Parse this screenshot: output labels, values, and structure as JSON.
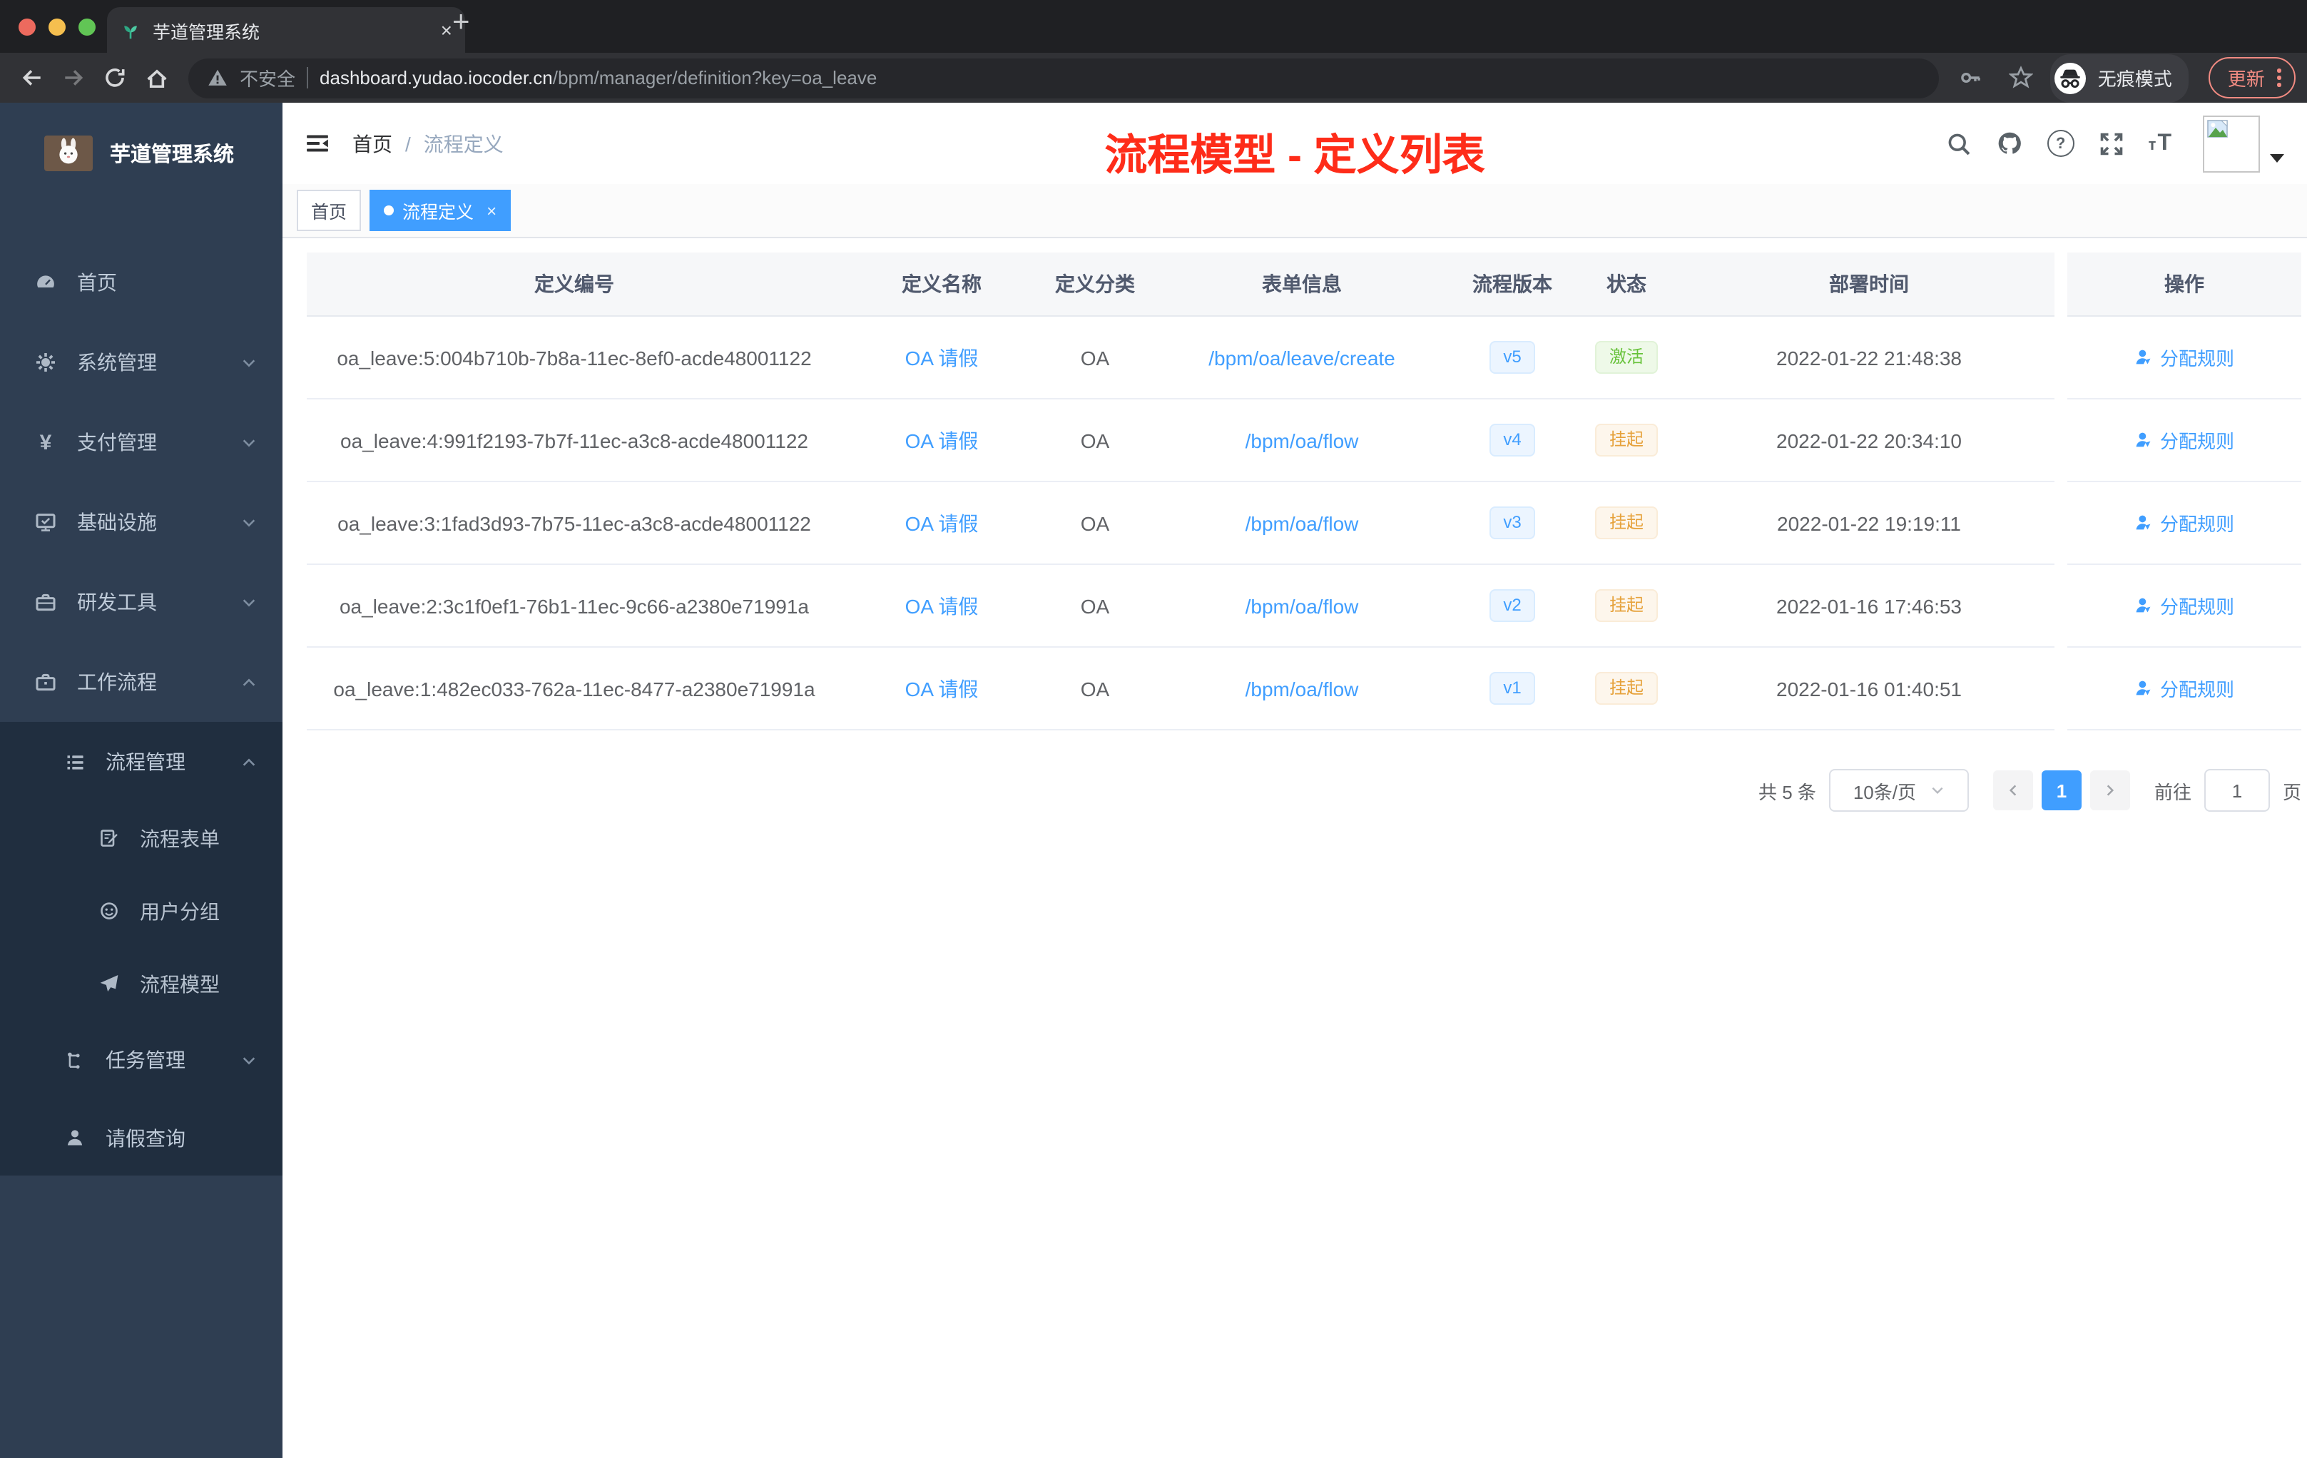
{
  "browser": {
    "tab": {
      "title": "芋道管理系统",
      "close": "×",
      "new_tab": "+"
    },
    "address": {
      "security_label": "不安全",
      "host": "dashboard.yudao.iocoder.cn",
      "path": "/bpm/manager/definition?key=oa_leave"
    },
    "actions": {
      "incognito_label": "无痕模式",
      "update_label": "更新"
    }
  },
  "sidebar": {
    "logo_title": "芋道管理系统",
    "items": [
      {
        "label": "首页",
        "icon": "gauge-icon",
        "expandable": false
      },
      {
        "label": "系统管理",
        "icon": "gear-icon",
        "expandable": true,
        "state": "collapsed"
      },
      {
        "label": "支付管理",
        "icon": "yen-icon",
        "expandable": true,
        "state": "collapsed"
      },
      {
        "label": "基础设施",
        "icon": "monitor-icon",
        "expandable": true,
        "state": "collapsed"
      },
      {
        "label": "研发工具",
        "icon": "toolbox-icon",
        "expandable": true,
        "state": "collapsed"
      },
      {
        "label": "工作流程",
        "icon": "briefcase-icon",
        "expandable": true,
        "state": "expanded"
      },
      {
        "label": "流程管理",
        "icon": "list-icon",
        "expandable": true,
        "state": "expanded"
      },
      {
        "label": "流程表单",
        "icon": "form-icon",
        "expandable": false
      },
      {
        "label": "用户分组",
        "icon": "users-icon",
        "expandable": false
      },
      {
        "label": "流程模型",
        "icon": "paper-plane-icon",
        "expandable": false
      },
      {
        "label": "任务管理",
        "icon": "tree-icon",
        "expandable": true,
        "state": "collapsed"
      },
      {
        "label": "请假查询",
        "icon": "person-icon",
        "expandable": false
      }
    ]
  },
  "header": {
    "breadcrumb_home": "首页",
    "breadcrumb_sep": "/",
    "breadcrumb_current": "流程定义"
  },
  "annotation": {
    "title": "流程模型 - 定义列表",
    "color": "#fe2c19"
  },
  "tags": {
    "home": "首页",
    "active": "流程定义",
    "close": "×"
  },
  "table": {
    "columns": [
      "定义编号",
      "定义名称",
      "定义分类",
      "表单信息",
      "流程版本",
      "状态",
      "部署时间",
      "操作"
    ],
    "rows": [
      {
        "id": "oa_leave:5:004b710b-7b8a-11ec-8ef0-acde48001122",
        "name": "OA 请假",
        "category": "OA",
        "form": "/bpm/oa/leave/create",
        "version": "v5",
        "status": "激活",
        "status_type": "success",
        "time": "2022-01-22 21:48:38",
        "action": "分配规则"
      },
      {
        "id": "oa_leave:4:991f2193-7b7f-11ec-a3c8-acde48001122",
        "name": "OA 请假",
        "category": "OA",
        "form": "/bpm/oa/flow",
        "version": "v4",
        "status": "挂起",
        "status_type": "warning",
        "time": "2022-01-22 20:34:10",
        "action": "分配规则"
      },
      {
        "id": "oa_leave:3:1fad3d93-7b75-11ec-a3c8-acde48001122",
        "name": "OA 请假",
        "category": "OA",
        "form": "/bpm/oa/flow",
        "version": "v3",
        "status": "挂起",
        "status_type": "warning",
        "time": "2022-01-22 19:19:11",
        "action": "分配规则"
      },
      {
        "id": "oa_leave:2:3c1f0ef1-76b1-11ec-9c66-a2380e71991a",
        "name": "OA 请假",
        "category": "OA",
        "form": "/bpm/oa/flow",
        "version": "v2",
        "status": "挂起",
        "status_type": "warning",
        "time": "2022-01-16 17:46:53",
        "action": "分配规则"
      },
      {
        "id": "oa_leave:1:482ec033-762a-11ec-8477-a2380e71991a",
        "name": "OA 请假",
        "category": "OA",
        "form": "/bpm/oa/flow",
        "version": "v1",
        "status": "挂起",
        "status_type": "warning",
        "time": "2022-01-16 01:40:51",
        "action": "分配规则"
      }
    ]
  },
  "pagination": {
    "total": "共 5 条",
    "page_size": "10条/页",
    "current_page": "1",
    "goto_label": "前往",
    "goto_value": "1",
    "unit_label": "页"
  },
  "colors": {
    "accent": "#409eff",
    "success": "#67c23a",
    "warning": "#e6a23c",
    "annotation_red": "#fe2c19",
    "sidebar_bg": "#2f3e52",
    "submenu_bg": "#202e3f"
  }
}
